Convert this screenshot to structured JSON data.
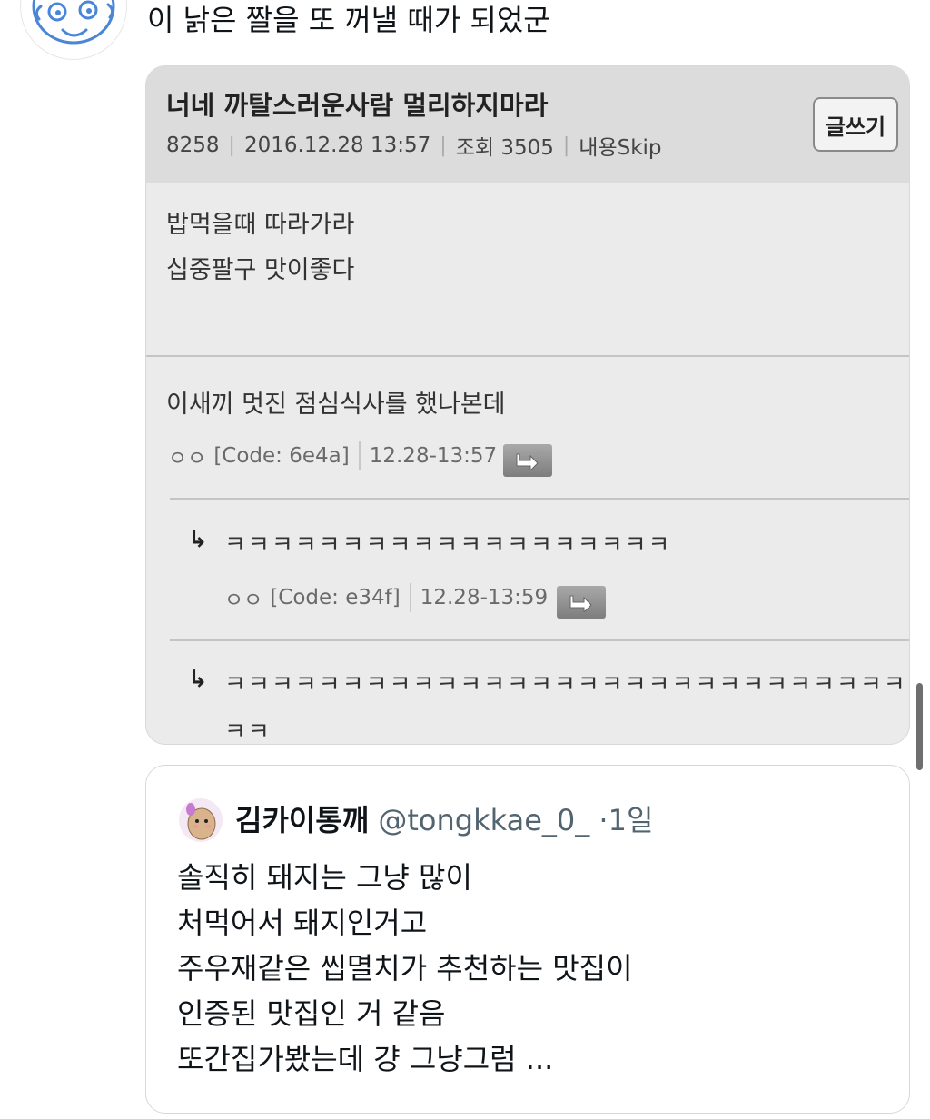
{
  "tweet": {
    "text": "이 낡은 짤을 또 꺼낼 때가 되었군"
  },
  "image": {
    "post": {
      "title": "너네 까탈스러운사람 멀리하지마라",
      "post_number": "8258",
      "datetime": "2016.12.28 13:57",
      "views": "조회 3505",
      "skip": "내용Skip",
      "write_button": "글쓰기",
      "body_lines": [
        "밥먹을때 따라가라",
        "십중팔구 맛이좋다"
      ]
    },
    "comments": [
      {
        "text": "이새끼 멋진 점심식사를 했나본데",
        "author": "ㅇㅇ",
        "code": "[Code: 6e4a]",
        "time": "12.28-13:57"
      }
    ],
    "replies": [
      {
        "arrow": "↳",
        "text": "ㅋㅋㅋㅋㅋㅋㅋㅋㅋㅋㅋㅋㅋㅋㅋㅋㅋㅋㅋ",
        "author": "ㅇㅇ",
        "code": "[Code: e34f]",
        "time": "12.28-13:59"
      },
      {
        "arrow": "↳",
        "text_line1": "ㅋㅋㅋㅋㅋㅋㅋㅋㅋㅋㅋㅋㅋㅋㅋㅋㅋㅋㅋㅋㅋㅋㅋㅋㅋㅋㅋㅋㅋㅋ",
        "text_line2": "ㅋㅋ"
      }
    ]
  },
  "quote": {
    "name": "김카이통깨",
    "handle": "@tongkkae_0_",
    "time": "·1일",
    "body_lines": [
      "솔직히 돼지는 그냥 많이",
      "처먹어서 돼지인거고",
      "주우재같은 씹멸치가 추천하는 맛집이",
      "인증된 맛집인 거 같음",
      "또간집가봤는데 걍 그냥그럼 ..."
    ]
  },
  "icons": {
    "avatar": "blue-doodle-face-avatar",
    "quote_avatar": "potato-character-avatar",
    "reply": "reply-arrow-icon"
  }
}
